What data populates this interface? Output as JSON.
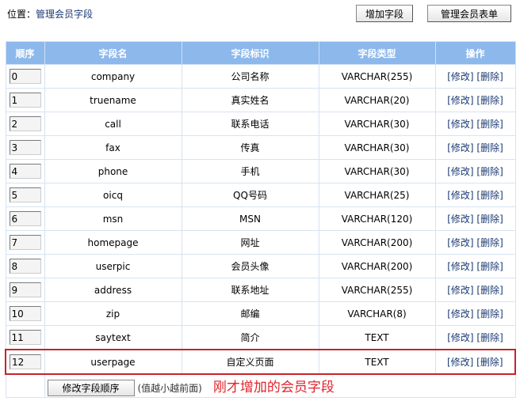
{
  "location": {
    "label": "位置：",
    "page": "管理会员字段"
  },
  "toolbar": {
    "add_field": "增加字段",
    "manage_forms": "管理会员表单"
  },
  "table": {
    "headers": [
      "顺序",
      "字段名",
      "字段标识",
      "字段类型",
      "操作"
    ],
    "edit_label": "[修改]",
    "delete_label": "[删除]",
    "rows": [
      {
        "order": "0",
        "name": "company",
        "label": "公司名称",
        "type": "VARCHAR(255)"
      },
      {
        "order": "1",
        "name": "truename",
        "label": "真实姓名",
        "type": "VARCHAR(20)"
      },
      {
        "order": "2",
        "name": "call",
        "label": "联系电话",
        "type": "VARCHAR(30)"
      },
      {
        "order": "3",
        "name": "fax",
        "label": "传真",
        "type": "VARCHAR(30)"
      },
      {
        "order": "4",
        "name": "phone",
        "label": "手机",
        "type": "VARCHAR(30)"
      },
      {
        "order": "5",
        "name": "oicq",
        "label": "QQ号码",
        "type": "VARCHAR(25)"
      },
      {
        "order": "6",
        "name": "msn",
        "label": "MSN",
        "type": "VARCHAR(120)"
      },
      {
        "order": "7",
        "name": "homepage",
        "label": "网址",
        "type": "VARCHAR(200)"
      },
      {
        "order": "8",
        "name": "userpic",
        "label": "会员头像",
        "type": "VARCHAR(200)"
      },
      {
        "order": "9",
        "name": "address",
        "label": "联系地址",
        "type": "VARCHAR(255)"
      },
      {
        "order": "10",
        "name": "zip",
        "label": "邮编",
        "type": "VARCHAR(8)"
      },
      {
        "order": "11",
        "name": "saytext",
        "label": "简介",
        "type": "TEXT"
      },
      {
        "order": "12",
        "name": "userpage",
        "label": "自定义页面",
        "type": "TEXT"
      }
    ]
  },
  "footer": {
    "reorder_button": "修改字段顺序",
    "hint": "(值越小越前面)",
    "annotation": "刚才增加的会员字段"
  },
  "highlight_color": "#c8222a"
}
